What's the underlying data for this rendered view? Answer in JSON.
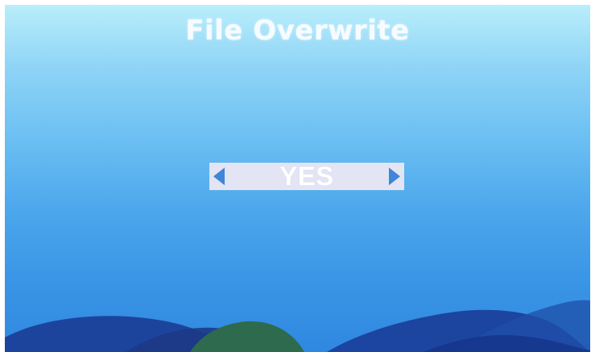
{
  "dialog": {
    "title": "File Overwrite",
    "value": "YES"
  },
  "icons": {
    "prev": "triangle-left-icon",
    "next": "triangle-right-icon"
  },
  "colors": {
    "background_top": "#b9eefb",
    "background_bottom": "#2f88e0",
    "selector_bar": "#e3e4f4",
    "arrow": "#3f86d8",
    "title_text": "#f7fbff",
    "wave_dark": "#1a3f9a",
    "wave_green": "#2e6b4e"
  }
}
